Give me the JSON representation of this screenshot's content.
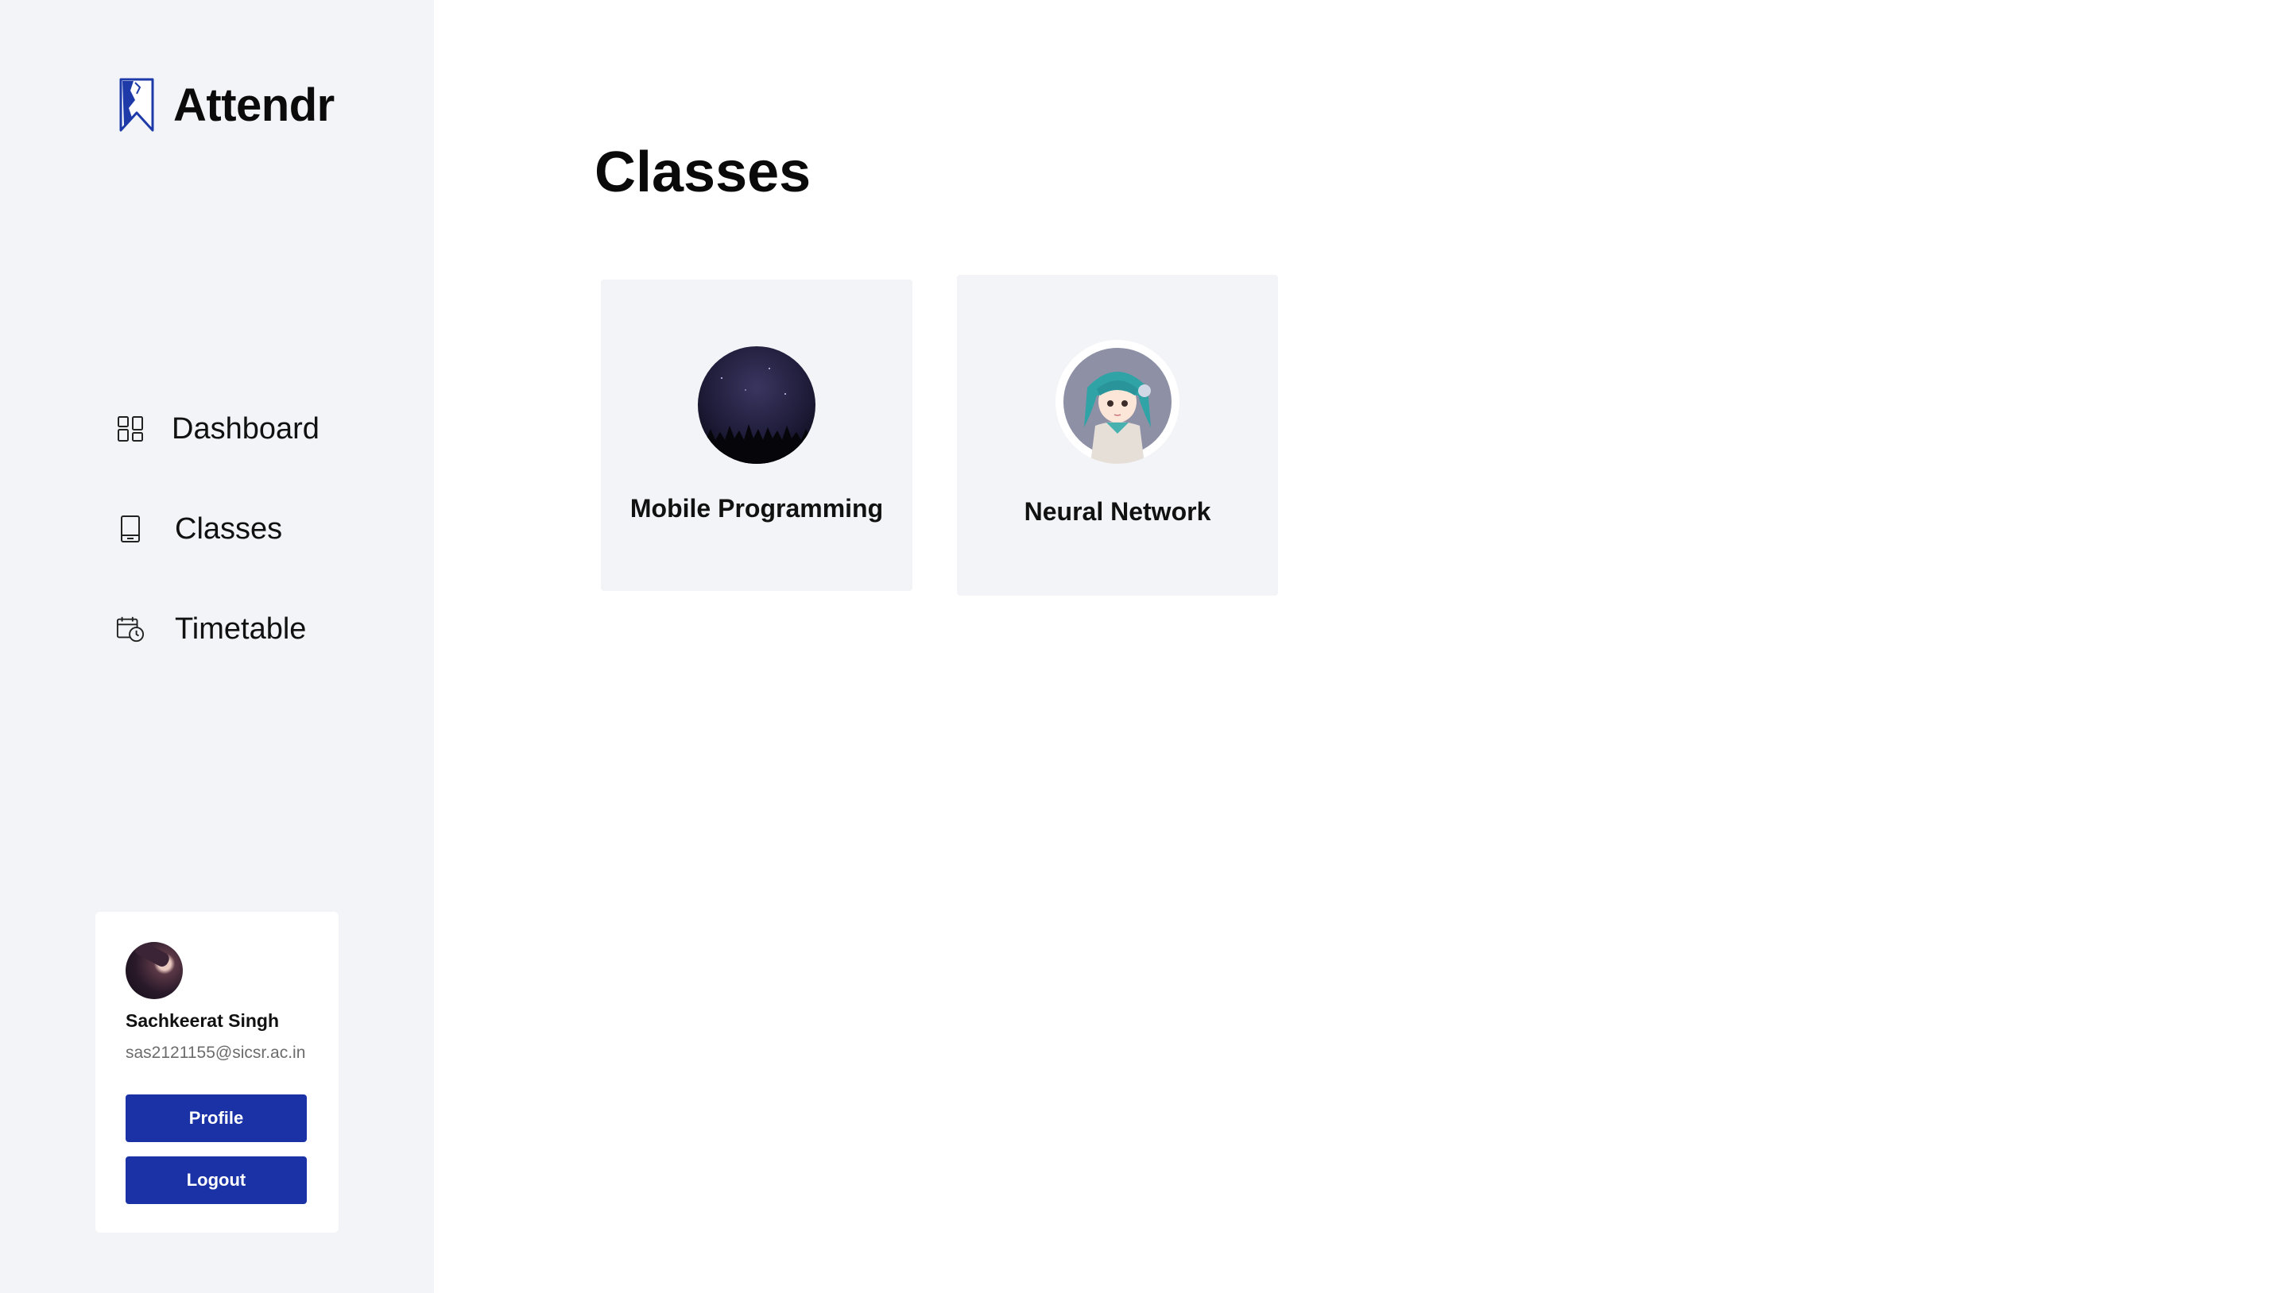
{
  "app": {
    "name": "Attendr"
  },
  "sidebar": {
    "nav": [
      {
        "label": "Dashboard",
        "icon": "dashboard-grid-icon"
      },
      {
        "label": "Classes",
        "icon": "book-icon"
      },
      {
        "label": "Timetable",
        "icon": "calendar-clock-icon"
      }
    ],
    "user": {
      "name": "Sachkeerat Singh",
      "email": "sas2121155@sicsr.ac.in",
      "profile_label": "Profile",
      "logout_label": "Logout"
    }
  },
  "main": {
    "title": "Classes",
    "classes": [
      {
        "name": "Mobile Programming",
        "image": "night-forest-avatar"
      },
      {
        "name": "Neural Network",
        "image": "anime-girl-avatar"
      }
    ]
  },
  "colors": {
    "sidebar_bg": "#f3f4f8",
    "card_bg": "#f3f4f8",
    "accent": "#1a32a6",
    "logo_blue": "#1e3aa8"
  }
}
